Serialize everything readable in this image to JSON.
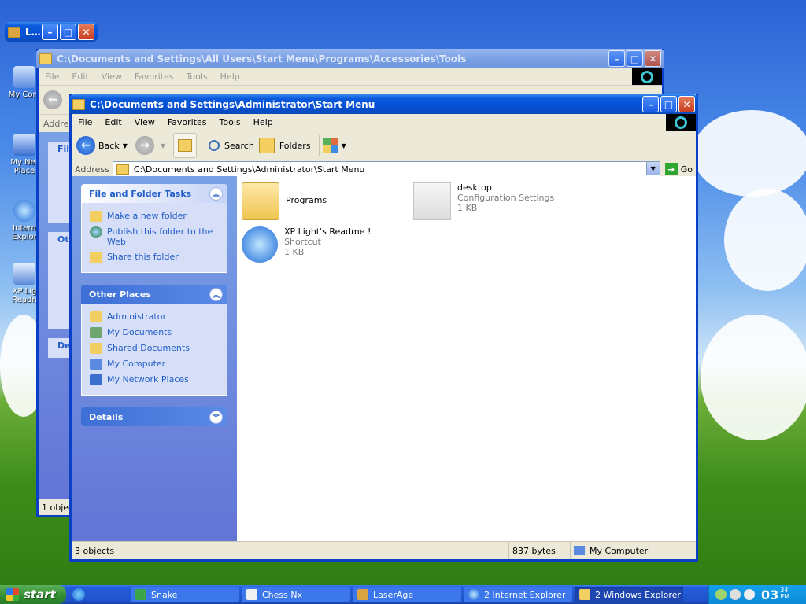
{
  "colors": {
    "accent": "#0a3fc8",
    "link": "#215dc6"
  },
  "desktop": {
    "icons": [
      {
        "label": "My Com"
      },
      {
        "label": "My Net Place"
      },
      {
        "label": "Intern Explor"
      },
      {
        "label": "XP Lig Readn"
      }
    ]
  },
  "mini_window": {
    "title": "L..."
  },
  "back_window": {
    "title": "C:\\Documents and Settings\\All Users\\Start Menu\\Programs\\Accessories\\Tools",
    "menu": [
      "File",
      "Edit",
      "View",
      "Favorites",
      "Tools",
      "Help"
    ],
    "address_label": "Addres",
    "panels": [
      "File",
      "Oth",
      "De"
    ],
    "status": "1 object"
  },
  "window": {
    "title": "C:\\Documents and Settings\\Administrator\\Start Menu",
    "menu": [
      "File",
      "Edit",
      "View",
      "Favorites",
      "Tools",
      "Help"
    ],
    "toolbar": {
      "back": "Back",
      "search": "Search",
      "folders": "Folders"
    },
    "address": {
      "label": "Address",
      "value": "C:\\Documents and Settings\\Administrator\\Start Menu",
      "go": "Go"
    },
    "tasks": {
      "title": "File and Folder Tasks",
      "items": [
        "Make a new folder",
        "Publish this folder to the Web",
        "Share this folder"
      ]
    },
    "other": {
      "title": "Other Places",
      "items": [
        "Administrator",
        "My Documents",
        "Shared Documents",
        "My Computer",
        "My Network Places"
      ]
    },
    "details": {
      "title": "Details"
    },
    "files": [
      {
        "name": "Programs",
        "type": "",
        "size": ""
      },
      {
        "name": "desktop",
        "type": "Configuration Settings",
        "size": "1 KB"
      },
      {
        "name": "XP Light's Readme !",
        "type": "Shortcut",
        "size": "1 KB"
      }
    ],
    "status": {
      "count": "3 objects",
      "size": "837 bytes",
      "location": "My Computer"
    }
  },
  "taskbar": {
    "start": "start",
    "tasks": [
      "Snake",
      "Chess Nx",
      "LaserAge",
      "2 Internet Explorer",
      "2 Windows Explorer"
    ],
    "clock": {
      "hour": "03",
      "min": "34",
      "ampm": "PM"
    }
  }
}
